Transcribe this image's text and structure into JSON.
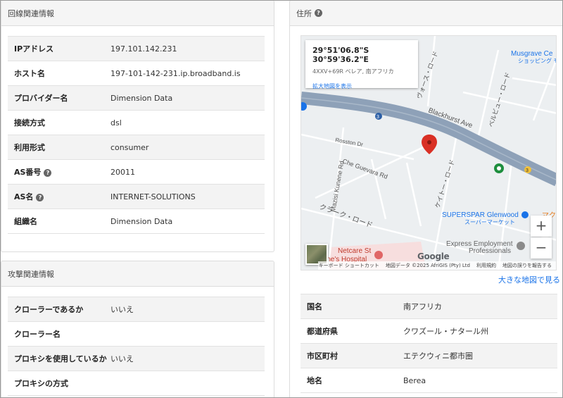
{
  "line_panel": {
    "title": "回線関連情報",
    "rows": [
      {
        "key": "IPアドレス",
        "value": "197.101.142.231",
        "help": false
      },
      {
        "key": "ホスト名",
        "value": "197-101-142-231.ip.broadband.is",
        "help": false
      },
      {
        "key": "プロバイダー名",
        "value": "Dimension Data",
        "help": false
      },
      {
        "key": "接続方式",
        "value": "dsl",
        "help": false
      },
      {
        "key": "利用形式",
        "value": "consumer",
        "help": false
      },
      {
        "key": "AS番号",
        "value": "20011",
        "help": true
      },
      {
        "key": "AS名",
        "value": "INTERNET-SOLUTIONS",
        "help": true
      },
      {
        "key": "組織名",
        "value": "Dimension Data",
        "help": false
      }
    ]
  },
  "attack_panel": {
    "title": "攻撃関連情報",
    "rows": [
      {
        "key": "クローラーであるか",
        "value": "いいえ"
      },
      {
        "key": "クローラー名",
        "value": ""
      },
      {
        "key": "プロキシを使用しているか",
        "value": "いいえ"
      },
      {
        "key": "プロキシの方式",
        "value": ""
      }
    ]
  },
  "address_panel": {
    "title": "住所",
    "big_map_link": "大きな地図で見る",
    "rows": [
      {
        "key": "国名",
        "value": "南アフリカ"
      },
      {
        "key": "都道府県",
        "value": "クワズール・ナタール州"
      },
      {
        "key": "市区町村",
        "value": "エテクウィニ都市圏"
      },
      {
        "key": "地名",
        "value": "Berea"
      }
    ]
  },
  "map": {
    "coords": "29°51'06.8\"S 30°59'36.2\"E",
    "address": "4XXV+69R ベレア, 南アフリカ",
    "enlarge_link": "拡大地図を表示",
    "zoom_in": "+",
    "zoom_out": "−",
    "footer": [
      "キーボード ショートカット",
      "地図データ ©2025 AfriGIS (Pty) Ltd",
      "利用規約",
      "地図の誤りを報告する"
    ],
    "google": "Google",
    "labels": {
      "blackhurst": "Blackhurst Ave",
      "musgrave": "Musgrave Ce",
      "musgrave_sub": "ショッピング モ",
      "rosston": "Rosston Dr",
      "mazisi": "Mazisi Kunene Rd",
      "che": "Che Guevara Rd",
      "clark": "クラーク・ロード",
      "vaus": "ヴォース・ロード",
      "bellevue": "ベルビュー・ロード",
      "keitt": "ケイトー・ロード",
      "superspar": "SUPERSPAR Glenwood",
      "supermarket": "スーパーマーケット",
      "express": "Express Employment",
      "professionals": "Professionals",
      "netcare": "Netcare St",
      "hospital": "ine's Hospital",
      "mak": "マク",
      "route3a": "3",
      "route3b": "3"
    },
    "colors": {
      "highway": "#8ea1b8",
      "road": "#ffffff",
      "land": "#eceff1",
      "pin": "#d93025",
      "park_pin": "#1e8e3e",
      "hospital": "#e06666"
    }
  }
}
